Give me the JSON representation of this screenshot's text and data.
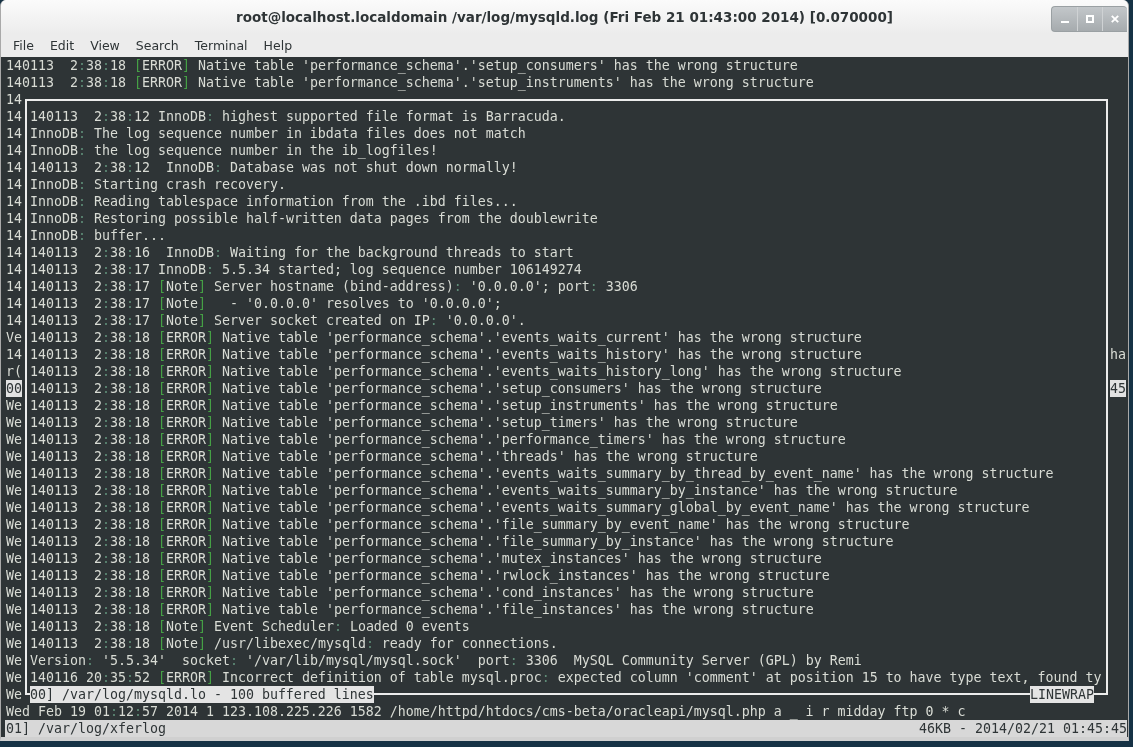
{
  "window": {
    "title": "root@localhost.localdomain /var/log/mysqld.log (Fri Feb 21 01:43:00 2014) [0.070000]"
  },
  "menu": [
    "File",
    "Edit",
    "View",
    "Search",
    "Terminal",
    "Help"
  ],
  "terminal": {
    "top_lines": [
      "140113  2:38:18 [ERROR] Native table 'performance_schema'.'setup_consumers' has the wrong structure",
      "140113  2:38:18 [ERROR] Native table 'performance_schema'.'setup_instruments' has the wrong structure"
    ],
    "underlying_rows": [
      {
        "left": {
          "text": "14",
          "inverted": false
        }
      },
      {
        "left": {
          "text": "14",
          "inverted": false
        }
      },
      {
        "left": {
          "text": "14",
          "inverted": false
        }
      },
      {
        "left": {
          "text": "14",
          "inverted": false
        }
      },
      {
        "left": {
          "text": "14",
          "inverted": false
        }
      },
      {
        "left": {
          "text": "14",
          "inverted": false
        }
      },
      {
        "left": {
          "text": "14",
          "inverted": false
        }
      },
      {
        "left": {
          "text": "14",
          "inverted": false
        }
      },
      {
        "left": {
          "text": "14",
          "inverted": false
        }
      },
      {
        "left": {
          "text": "14",
          "inverted": false
        }
      },
      {
        "left": {
          "text": "14",
          "inverted": false
        }
      },
      {
        "left": {
          "text": "14",
          "inverted": false
        }
      },
      {
        "left": {
          "text": "14",
          "inverted": false
        }
      },
      {
        "left": {
          "text": "14",
          "inverted": false
        }
      },
      {
        "left": {
          "text": "Ve",
          "inverted": false
        }
      },
      {
        "left": {
          "text": "14",
          "inverted": false
        },
        "right": {
          "text": "ha",
          "inverted": false
        }
      },
      {
        "left": {
          "text": "r(",
          "inverted": false
        }
      },
      {
        "left": {
          "text": "00",
          "inverted": true
        },
        "right": {
          "text": "45",
          "inverted": true
        }
      },
      {
        "left": {
          "text": "We",
          "inverted": false
        }
      },
      {
        "left": {
          "text": "We",
          "inverted": false
        }
      },
      {
        "left": {
          "text": "We",
          "inverted": false
        }
      },
      {
        "left": {
          "text": "We",
          "inverted": false
        }
      },
      {
        "left": {
          "text": "We",
          "inverted": false
        }
      },
      {
        "left": {
          "text": "We",
          "inverted": false
        }
      },
      {
        "left": {
          "text": "We",
          "inverted": false
        }
      },
      {
        "left": {
          "text": "We",
          "inverted": false
        }
      },
      {
        "left": {
          "text": "We",
          "inverted": false
        }
      },
      {
        "left": {
          "text": "We",
          "inverted": false
        }
      },
      {
        "left": {
          "text": "We",
          "inverted": false
        }
      },
      {
        "left": {
          "text": "We",
          "inverted": false
        }
      },
      {
        "left": {
          "text": "We",
          "inverted": false
        }
      },
      {
        "left": {
          "text": "We",
          "inverted": false
        }
      },
      {
        "left": {
          "text": "We",
          "inverted": false
        }
      },
      {
        "left": {
          "text": "We",
          "inverted": false
        }
      },
      {
        "left": {
          "text": "We",
          "inverted": false
        }
      },
      {
        "left": {
          "text": "We",
          "inverted": false
        }
      }
    ],
    "popup": {
      "lines": [
        "140113  2:38:12 InnoDB: highest supported file format is Barracuda.",
        "InnoDB: The log sequence number in ibdata files does not match",
        "InnoDB: the log sequence number in the ib_logfiles!",
        "140113  2:38:12  InnoDB: Database was not shut down normally!",
        "InnoDB: Starting crash recovery.",
        "InnoDB: Reading tablespace information from the .ibd files...",
        "InnoDB: Restoring possible half-written data pages from the doublewrite",
        "InnoDB: buffer...",
        "140113  2:38:16  InnoDB: Waiting for the background threads to start",
        "140113  2:38:17 InnoDB: 5.5.34 started; log sequence number 106149274",
        "140113  2:38:17 [Note] Server hostname (bind-address): '0.0.0.0'; port: 3306",
        "140113  2:38:17 [Note]   - '0.0.0.0' resolves to '0.0.0.0';",
        "140113  2:38:17 [Note] Server socket created on IP: '0.0.0.0'.",
        "140113  2:38:18 [ERROR] Native table 'performance_schema'.'events_waits_current' has the wrong structure",
        "140113  2:38:18 [ERROR] Native table 'performance_schema'.'events_waits_history' has the wrong structure",
        "140113  2:38:18 [ERROR] Native table 'performance_schema'.'events_waits_history_long' has the wrong structure",
        "140113  2:38:18 [ERROR] Native table 'performance_schema'.'setup_consumers' has the wrong structure",
        "140113  2:38:18 [ERROR] Native table 'performance_schema'.'setup_instruments' has the wrong structure",
        "140113  2:38:18 [ERROR] Native table 'performance_schema'.'setup_timers' has the wrong structure",
        "140113  2:38:18 [ERROR] Native table 'performance_schema'.'performance_timers' has the wrong structure",
        "140113  2:38:18 [ERROR] Native table 'performance_schema'.'threads' has the wrong structure",
        "140113  2:38:18 [ERROR] Native table 'performance_schema'.'events_waits_summary_by_thread_by_event_name' has the wrong structure",
        "140113  2:38:18 [ERROR] Native table 'performance_schema'.'events_waits_summary_by_instance' has the wrong structure",
        "140113  2:38:18 [ERROR] Native table 'performance_schema'.'events_waits_summary_global_by_event_name' has the wrong structure",
        "140113  2:38:18 [ERROR] Native table 'performance_schema'.'file_summary_by_event_name' has the wrong structure",
        "140113  2:38:18 [ERROR] Native table 'performance_schema'.'file_summary_by_instance' has the wrong structure",
        "140113  2:38:18 [ERROR] Native table 'performance_schema'.'mutex_instances' has the wrong structure",
        "140113  2:38:18 [ERROR] Native table 'performance_schema'.'rwlock_instances' has the wrong structure",
        "140113  2:38:18 [ERROR] Native table 'performance_schema'.'cond_instances' has the wrong structure",
        "140113  2:38:18 [ERROR] Native table 'performance_schema'.'file_instances' has the wrong structure",
        "140113  2:38:18 [Note] Event Scheduler: Loaded 0 events",
        "140113  2:38:18 [Note] /usr/libexec/mysqld: ready for connections.",
        "Version: '5.5.34'  socket: '/var/lib/mysql/mysql.sock'  port: 3306  MySQL Community Server (GPL) by Remi",
        "140116 20:35:52 [ERROR] Incorrect definition of table mysql.proc: expected column 'comment' at position 15 to have type text, found ty"
      ],
      "status": "00] /var/log/mysqld.lo - 100 buffered lines",
      "mode": "LINEWRAP"
    },
    "bottom_lines": [
      "Wed Feb 19 01:12:57 2014 1 123.108.225.226 1582 /home/httpd/htdocs/cms-beta/oracleapi/mysql.php a _ i r midday ftp 0 * c"
    ],
    "status_bar": {
      "file": "01] /var/log/xferlog",
      "info": "46KB - 2014/02/21 01:45:45"
    }
  }
}
